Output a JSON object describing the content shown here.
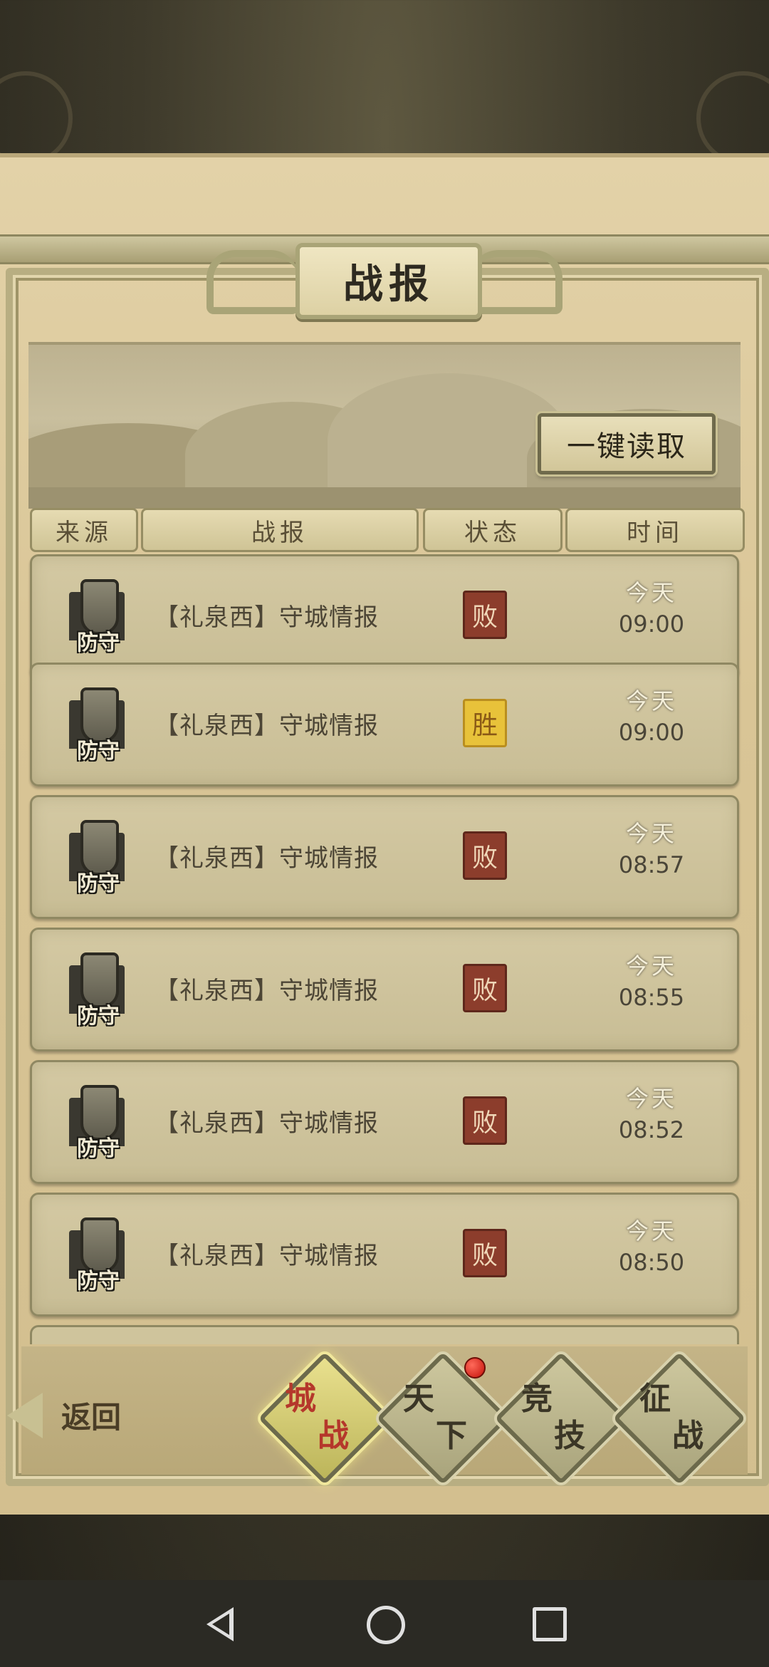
{
  "header": {
    "title": "战报",
    "read_all_label": "一键读取"
  },
  "columns": [
    "来源",
    "战报",
    "状态",
    "时间"
  ],
  "reports": [
    {
      "source": "防守",
      "title": "【礼泉西】守城情报",
      "status": "败",
      "result": "lose",
      "day": "今天",
      "time": "09:00"
    },
    {
      "source": "防守",
      "title": "【礼泉西】守城情报",
      "status": "胜",
      "result": "win",
      "day": "今天",
      "time": "09:00"
    },
    {
      "source": "防守",
      "title": "【礼泉西】守城情报",
      "status": "败",
      "result": "lose",
      "day": "今天",
      "time": "08:57"
    },
    {
      "source": "防守",
      "title": "【礼泉西】守城情报",
      "status": "败",
      "result": "lose",
      "day": "今天",
      "time": "08:55"
    },
    {
      "source": "防守",
      "title": "【礼泉西】守城情报",
      "status": "败",
      "result": "lose",
      "day": "今天",
      "time": "08:52"
    },
    {
      "source": "防守",
      "title": "【礼泉西】守城情报",
      "status": "败",
      "result": "lose",
      "day": "今天",
      "time": "08:50"
    }
  ],
  "bottom_nav": {
    "back_label": "返回",
    "tabs": [
      {
        "c1": "城",
        "c2": "战",
        "active": true,
        "badge": false
      },
      {
        "c1": "天",
        "c2": "下",
        "active": false,
        "badge": true
      },
      {
        "c1": "竞",
        "c2": "技",
        "active": false,
        "badge": false
      },
      {
        "c1": "征",
        "c2": "战",
        "active": false,
        "badge": false
      }
    ]
  },
  "colors": {
    "lose_badge": "#8c3d2c",
    "win_badge": "#e8c23a",
    "active_tab_text": "#b5372b",
    "notification_dot": "#e02a1e"
  },
  "icons": {
    "row_source": "fortress-shield-icon",
    "system_back": "triangle-back-icon",
    "system_home": "circle-home-icon",
    "system_recent": "square-recent-icon"
  }
}
